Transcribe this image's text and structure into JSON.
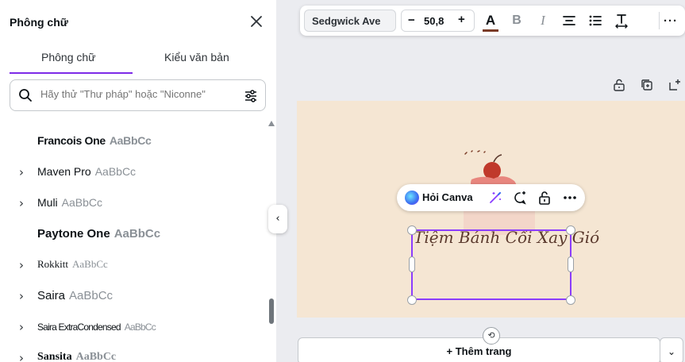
{
  "panel": {
    "title": "Phông chữ",
    "tabs": [
      {
        "label": "Phông chữ",
        "active": true
      },
      {
        "label": "Kiểu văn bản",
        "active": false
      }
    ],
    "search": {
      "placeholder": "Hãy thử \"Thư pháp\" hoặc \"Niconne\""
    },
    "fonts": [
      {
        "name": "Francois One",
        "sample": "AaBbCc",
        "expandable": false
      },
      {
        "name": "Maven Pro",
        "sample": "AaBbCc",
        "expandable": true
      },
      {
        "name": "Muli",
        "sample": "AaBbCc",
        "expandable": true
      },
      {
        "name": "Paytone One",
        "sample": "AaBbCc",
        "expandable": false
      },
      {
        "name": "Rokkitt",
        "sample": "AaBbCc",
        "expandable": true
      },
      {
        "name": "Saira",
        "sample": "AaBbCc",
        "expandable": true
      },
      {
        "name": "Saira ExtraCondensed",
        "sample": "AaBbCc",
        "expandable": true
      },
      {
        "name": "Sansita",
        "sample": "AaBbCc",
        "expandable": true
      }
    ]
  },
  "toolbar": {
    "font_name": "Sedgwick Ave",
    "font_size": "50,8",
    "minus": "−",
    "plus": "+",
    "text_color": "#7a3b26",
    "more": "···"
  },
  "ask_bar": {
    "label": "Hỏi Canva"
  },
  "canvas": {
    "text": "Tiệm Bánh Cối Xay Gió",
    "background": "#f5e6d3"
  },
  "add_page": {
    "label": "+ Thêm trang"
  },
  "colors": {
    "accent": "#8b3dff",
    "tab_underline": "#7d2ae8"
  }
}
